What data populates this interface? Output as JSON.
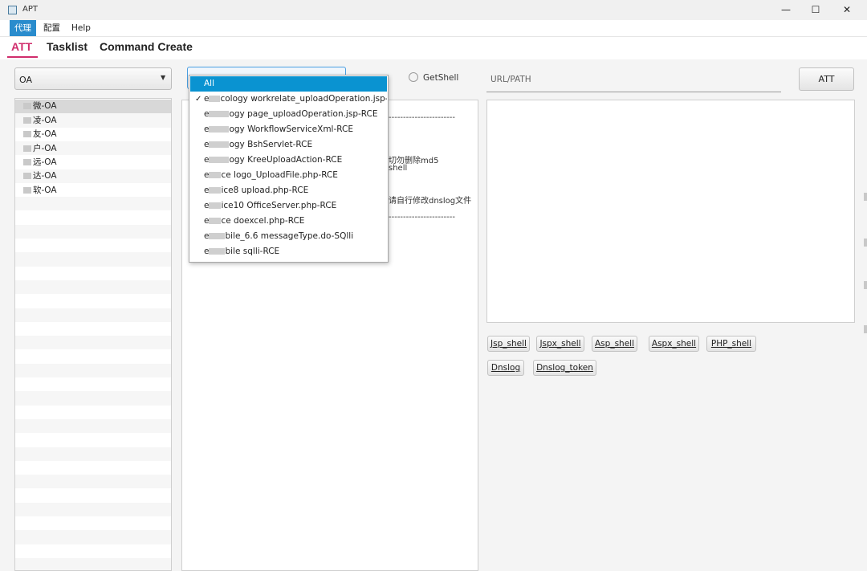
{
  "window": {
    "title": "APT",
    "minimize": "—",
    "maximize": "☐",
    "close": "✕"
  },
  "menubar": {
    "items": [
      "代理",
      "配置",
      "Help"
    ]
  },
  "tabs": [
    "ATT",
    "Tasklist",
    "Command Create"
  ],
  "left_panel": {
    "select_value": "OA",
    "vendors": [
      "微-OA",
      "凌-OA",
      "友-OA",
      "户-OA",
      "远-OA",
      "达-OA",
      "软-OA"
    ]
  },
  "center": {
    "getshell_label": "GetShell",
    "output_fragments": [
      "-----------------------",
      "切勿删除md5",
      "shell",
      "请自行修改dnslog文件",
      "-----------------------"
    ]
  },
  "dropdown": {
    "items": [
      {
        "prefix": "",
        "text": "All",
        "selected": true,
        "checked": false
      },
      {
        "prefix": "e",
        "text": "cology workrelate_uploadOperation.jsp-RCE",
        "selected": false,
        "checked": true
      },
      {
        "prefix": "e",
        "text": "ogy page_uploadOperation.jsp-RCE",
        "selected": false,
        "checked": false
      },
      {
        "prefix": "e",
        "text": "ogy WorkflowServiceXml-RCE",
        "selected": false,
        "checked": false
      },
      {
        "prefix": "e",
        "text": "ogy BshServlet-RCE",
        "selected": false,
        "checked": false
      },
      {
        "prefix": "e",
        "text": "ogy KreeUploadAction-RCE",
        "selected": false,
        "checked": false
      },
      {
        "prefix": "e",
        "text": "ce logo_UploadFile.php-RCE",
        "selected": false,
        "checked": false
      },
      {
        "prefix": "e",
        "text": "ice8 upload.php-RCE",
        "selected": false,
        "checked": false
      },
      {
        "prefix": "e",
        "text": "ice10 OfficeServer.php-RCE",
        "selected": false,
        "checked": false
      },
      {
        "prefix": "e",
        "text": "ce doexcel.php-RCE",
        "selected": false,
        "checked": false
      },
      {
        "prefix": "e",
        "text": "bile_6.6 messageType.do-SQlli",
        "selected": false,
        "checked": false
      },
      {
        "prefix": "e",
        "text": "bile sqlli-RCE",
        "selected": false,
        "checked": false
      }
    ],
    "check_glyph": "✓"
  },
  "right_panel": {
    "url_placeholder": "URL/PATH",
    "att_button": "ATT",
    "shell_buttons": [
      "Jsp_shell",
      "Jspx_shell",
      "Asp_shell",
      "Aspx_shell",
      "PHP_shell"
    ],
    "dns_buttons": [
      "Dnslog",
      "Dnslog_token"
    ]
  },
  "colors": {
    "accent_tab": "#d02d6c",
    "selection": "#0a93d1",
    "menu_active": "#2a8ccd"
  }
}
